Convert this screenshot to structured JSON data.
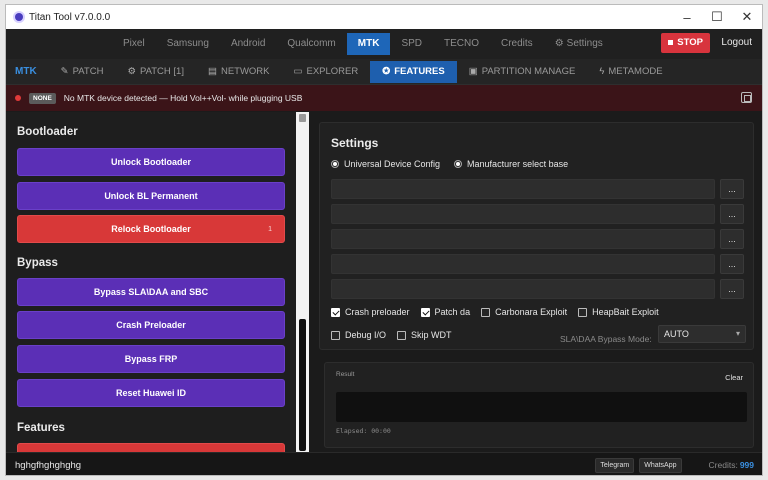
{
  "window": {
    "title": "Titan Tool v7.0.0.0",
    "controls": [
      "–",
      "☐",
      "✕"
    ]
  },
  "topnav": {
    "tabs": [
      "Pixel",
      "Samsung",
      "Android",
      "Qualcomm",
      "MTK",
      "SPD",
      "TECNO",
      "Credits",
      "Settings"
    ],
    "active": "MTK",
    "stop_label": "STOP",
    "logout_label": "Logout"
  },
  "subnav": {
    "section": "MTK",
    "tabs": [
      {
        "label": "PATCH",
        "icon": "wrench-icon"
      },
      {
        "label": "PATCH [1]",
        "icon": "gear-icon"
      },
      {
        "label": "NETWORK",
        "icon": "network-icon"
      },
      {
        "label": "EXPLORER",
        "icon": "folder-icon"
      },
      {
        "label": "FEATURES",
        "icon": "features-icon"
      },
      {
        "label": "PARTITION MANAGE",
        "icon": "partition-icon"
      },
      {
        "label": "METAMODE",
        "icon": "bolt-icon"
      }
    ],
    "active": "FEATURES"
  },
  "status": {
    "badge": "NONE",
    "message": "No MTK device detected — Hold Vol++Vol- while plugging USB"
  },
  "left_panel": {
    "sections": [
      {
        "title": "Bootloader",
        "buttons": [
          {
            "label": "Unlock Bootloader",
            "color": "#5b2fb6"
          },
          {
            "label": "Unlock BL Permanent",
            "color": "#5b2fb6"
          },
          {
            "label": "Relock Bootloader",
            "color": "#d83838",
            "tag": "1"
          }
        ]
      },
      {
        "title": "Bypass",
        "buttons": [
          {
            "label": "Bypass SLA\\DAA and SBC",
            "color": "#5b2fb6"
          },
          {
            "label": "Crash Preloader",
            "color": "#5b2fb6"
          },
          {
            "label": "Bypass FRP",
            "color": "#5b2fb6"
          },
          {
            "label": "Reset Huawei ID",
            "color": "#5b2fb6"
          }
        ]
      },
      {
        "title": "Features",
        "buttons": [
          {
            "label": "",
            "color": "#d83838"
          }
        ]
      }
    ]
  },
  "settings": {
    "title": "Settings",
    "radios": [
      {
        "label": "Universal Device Config",
        "selected": true
      },
      {
        "label": "Manufacturer select base",
        "selected": false
      }
    ],
    "fields": [
      {
        "value": "",
        "button": "..."
      },
      {
        "value": "",
        "button": "..."
      },
      {
        "value": "",
        "button": "..."
      },
      {
        "value": "",
        "button": "..."
      },
      {
        "value": "",
        "button": "..."
      }
    ],
    "checks_row1": [
      {
        "label": "Crash preloader",
        "checked": true
      },
      {
        "label": "Patch da",
        "checked": true
      },
      {
        "label": "Carbonara Exploit",
        "checked": false
      },
      {
        "label": "HeapBait Exploit",
        "checked": false
      }
    ],
    "checks_row2": [
      {
        "label": "Debug I/O",
        "checked": false
      },
      {
        "label": "Skip WDT",
        "checked": false
      }
    ],
    "mode_label": "SLA\\DAA Bypass Mode:",
    "mode_value": "AUTO"
  },
  "result": {
    "label": "Result",
    "clear_label": "Clear",
    "elapsed": "Elapsed: 00:00"
  },
  "footer": {
    "text": "hghgfhghghghg",
    "buttons": [
      "Telegram",
      "WhatsApp"
    ],
    "credits_label": "Credits:",
    "credits_value": "999"
  }
}
